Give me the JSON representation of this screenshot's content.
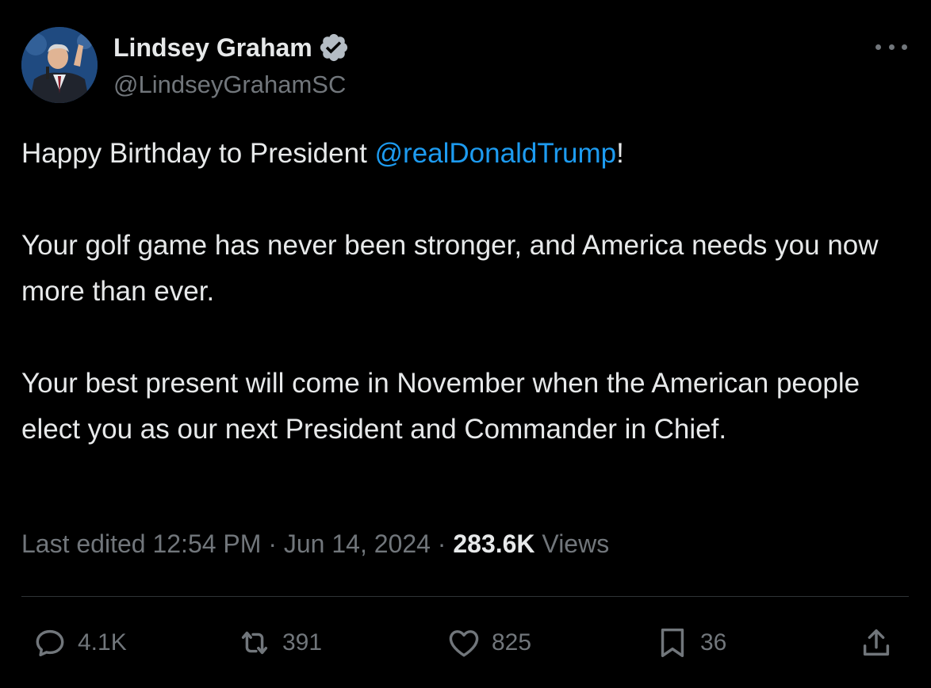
{
  "author": {
    "name": "Lindsey Graham",
    "handle": "@LindseyGrahamSC"
  },
  "tweet": {
    "line1_prefix": "Happy Birthday to President ",
    "mention": "@realDonaldTrump",
    "line1_suffix": "!",
    "paragraph2": "Your golf game has never been stronger, and America needs you now more than ever.",
    "paragraph3": "Your best present will come in November when the American people elect you as our next President and Commander in Chief."
  },
  "meta": {
    "edited_label": "Last edited",
    "time": "12:54 PM",
    "separator": "·",
    "date": "Jun 14, 2024",
    "views_count": "283.6K",
    "views_label": "Views"
  },
  "actions": {
    "replies": "4.1K",
    "reposts": "391",
    "likes": "825",
    "bookmarks": "36"
  },
  "icons": {
    "verified": "verified-badge-icon",
    "more": "more-horizontal-icon",
    "reply": "reply-icon",
    "repost": "repost-icon",
    "like": "heart-icon",
    "bookmark": "bookmark-icon",
    "share": "share-icon"
  },
  "colors": {
    "background": "#000000",
    "text": "#e7e9ea",
    "secondary": "#71767b",
    "accent": "#1d9bf0",
    "divider": "#2f3336"
  }
}
